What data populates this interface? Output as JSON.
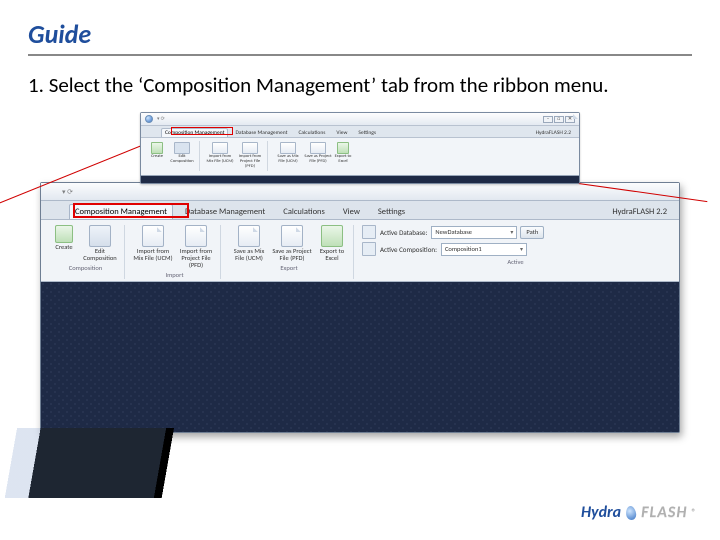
{
  "title": "Guide",
  "body": "1. Select the ‘Composition Management’ tab from the ribbon menu.",
  "tabs": {
    "composition": "Composition Management",
    "database": "Database Management",
    "calculations": "Calculations",
    "view": "View",
    "settings": "Settings",
    "hydraflash": "HydraFLASH 2.2"
  },
  "ribbon": {
    "create": "Create",
    "edit_comp": "Edit Composition",
    "import_ucm": "Import from Mix File (UCM)",
    "import_pfd": "Import from Project File (PFD)",
    "save_mix": "Save as Mix File (UCM)",
    "save_project": "Save as Project File (PFD)",
    "export_excel": "Export to Excel",
    "groups": {
      "composition": "Composition",
      "import": "Import",
      "export": "Export",
      "active": "Active"
    }
  },
  "active": {
    "db_label": "Active Database:",
    "comp_label": "Active Composition:",
    "db_value": "NewDatabase",
    "comp_value": "Composition1",
    "path_btn": "Path"
  },
  "brand": {
    "hydra": "Hydra",
    "flash": "FLASH"
  },
  "window": {
    "min": "–",
    "max": "□",
    "close": "✕"
  }
}
